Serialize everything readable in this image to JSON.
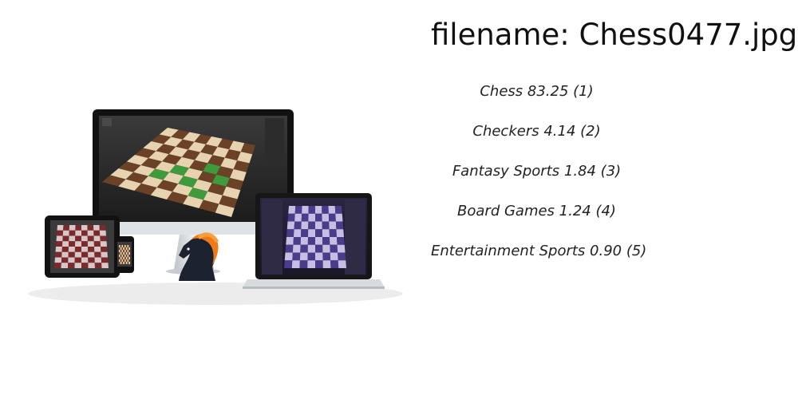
{
  "header": {
    "filename_label": "filename: Chess0477.jpg"
  },
  "predictions": [
    {
      "label": "Chess",
      "text": "Chess 83.25 (1)"
    },
    {
      "label": "Checkers",
      "text": "Checkers  4.14 (2)"
    },
    {
      "label": "Fantasy Sports",
      "text": "Fantasy Sports  1.84 (3)"
    },
    {
      "label": "Board Games",
      "text": "Board Games  1.24 (4)"
    },
    {
      "label": "Entertainment Sports",
      "text": "Entertainment Sports  0.90 (5)"
    }
  ],
  "colors": {
    "background": "#ffffff",
    "text": "#111111",
    "board_dark": "#6b4226",
    "board_light": "#e8d3b0",
    "board_green": "#3e9a3a",
    "knight_mane": "#f07a17"
  }
}
